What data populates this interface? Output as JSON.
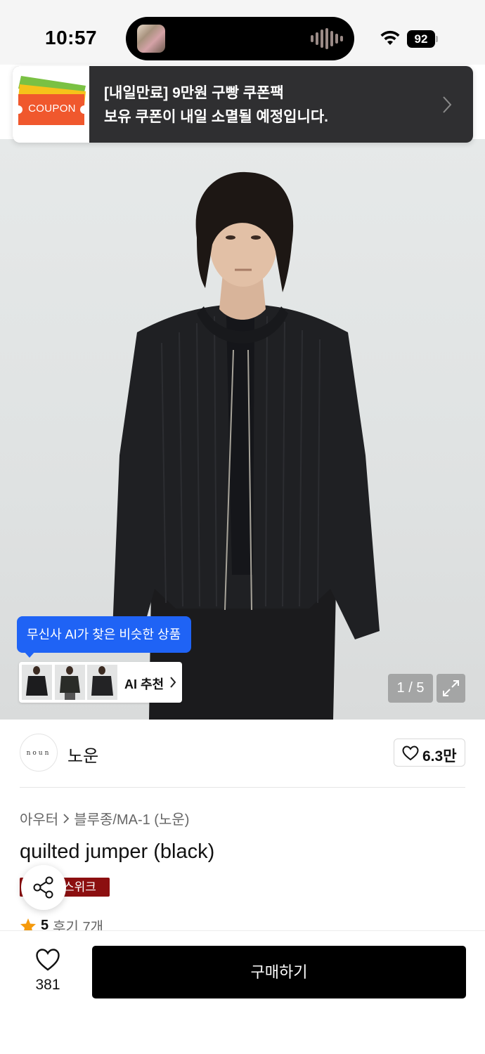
{
  "status_bar": {
    "time": "10:57",
    "battery": "92"
  },
  "coupon_banner": {
    "art_label": "COUPON",
    "line1": "[내일만료] 9만원 구빵 쿠폰팩",
    "line2": "보유 쿠폰이 내일 소멸될 예정입니다."
  },
  "ai_recommend": {
    "tooltip": "무신사 AI가 찾은 비슷한 상품",
    "button_label": "AI 추천"
  },
  "gallery": {
    "counter": "1 / 5"
  },
  "brand": {
    "logo_text": "noun",
    "name": "노운",
    "likes": "6.3만"
  },
  "product": {
    "breadcrumb_category": "아우터",
    "breadcrumb_subcategory": "블루종/MA-1 (노운)",
    "title": "quilted jumper (black)",
    "badge_text": "스위크",
    "rating": "5",
    "review_text": "후기 7개"
  },
  "bottom_bar": {
    "wish_count": "381",
    "buy_label": "구매하기"
  },
  "colors": {
    "accent_blue": "#1f63f5",
    "badge_red": "#8c0f10",
    "coupon_bg": "#2f2f31",
    "star": "#f59a0c"
  }
}
